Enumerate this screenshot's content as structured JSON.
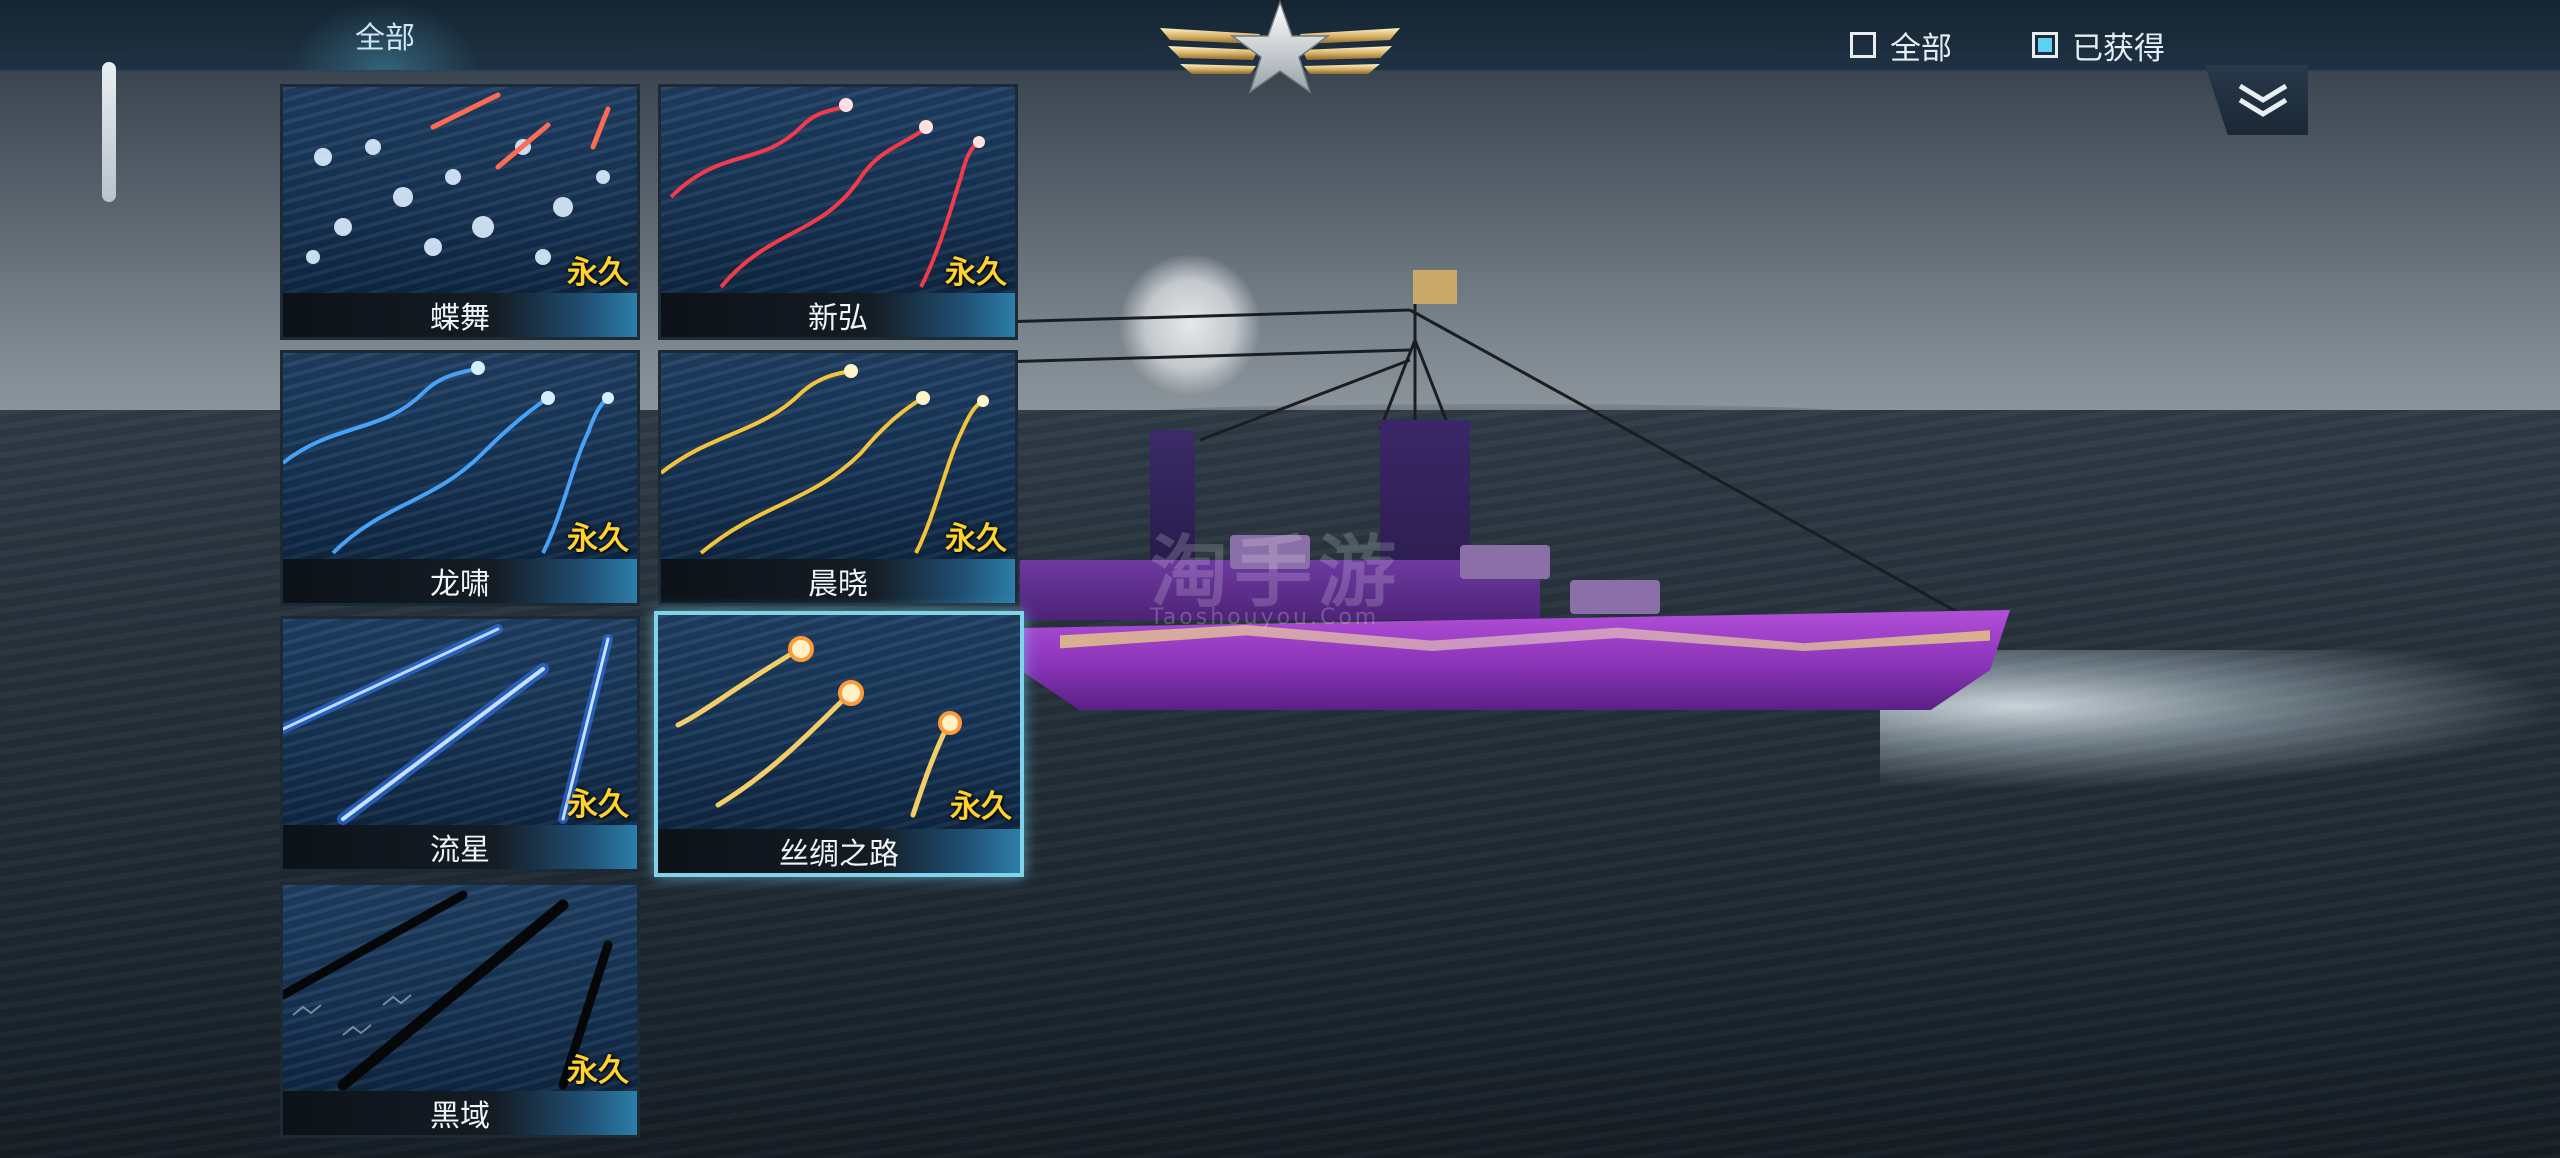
{
  "header": {
    "tab_all": "全部",
    "filters": [
      {
        "label": "全部",
        "checked": false
      },
      {
        "label": "已获得",
        "checked": true
      }
    ]
  },
  "watermark": {
    "main": "淘手游",
    "sub": "Taoshouyou.Com"
  },
  "skins": [
    {
      "name": "蝶舞",
      "duration": "永久",
      "effect": "butterfly",
      "accent": "#ff6a55",
      "selected": false
    },
    {
      "name": "新弘",
      "duration": "永久",
      "effect": "lightning",
      "accent": "#ff3b4a",
      "selected": false
    },
    {
      "name": "龙啸",
      "duration": "永久",
      "effect": "lightning",
      "accent": "#4aa8ff",
      "selected": false
    },
    {
      "name": "晨晓",
      "duration": "永久",
      "effect": "lightning",
      "accent": "#ffcc3a",
      "selected": false
    },
    {
      "name": "流星",
      "duration": "永久",
      "effect": "beam",
      "accent": "#3f8cff",
      "selected": false
    },
    {
      "name": "丝绸之路",
      "duration": "永久",
      "effect": "orb",
      "accent": "#ffd66a",
      "selected": true
    },
    {
      "name": "黑域",
      "duration": "永久",
      "effect": "dark",
      "accent": "#0b0f12",
      "selected": false
    }
  ],
  "icons": {
    "emblem": "winged-star-emblem",
    "collapse": "double-chevron-down-icon"
  }
}
